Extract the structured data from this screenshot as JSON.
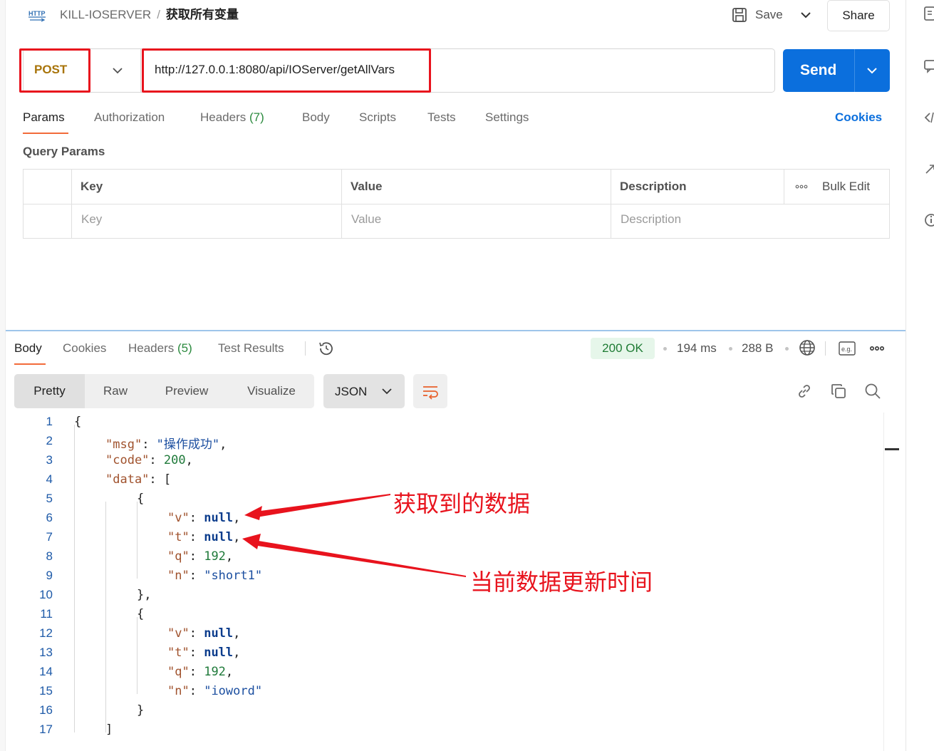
{
  "header": {
    "http_badge": "HTTP",
    "collection": "KILL-IOSERVER",
    "separator": "/",
    "request_name": "获取所有变量",
    "save_label": "Save",
    "share_label": "Share"
  },
  "request": {
    "method": "POST",
    "url": "http://127.0.0.1:8080/api/IOServer/getAllVars",
    "send_label": "Send"
  },
  "request_tabs": {
    "params": "Params",
    "authorization": "Authorization",
    "headers": "Headers",
    "headers_count": "(7)",
    "body": "Body",
    "scripts": "Scripts",
    "tests": "Tests",
    "settings": "Settings",
    "cookies": "Cookies"
  },
  "query_params": {
    "title": "Query Params",
    "columns": [
      "Key",
      "Value",
      "Description"
    ],
    "bulk_edit": "Bulk Edit",
    "placeholders": [
      "Key",
      "Value",
      "Description"
    ]
  },
  "response_tabs": {
    "body": "Body",
    "cookies": "Cookies",
    "headers": "Headers",
    "headers_count": "(5)",
    "test_results": "Test Results"
  },
  "response_meta": {
    "status": "200 OK",
    "time": "194 ms",
    "size": "288 B",
    "status_color": "#1e7b34"
  },
  "format_toolbar": {
    "modes": [
      "Pretty",
      "Raw",
      "Preview",
      "Visualize"
    ],
    "selected_mode": "Pretty",
    "language": "JSON"
  },
  "code": {
    "line_numbers": [
      "1",
      "2",
      "3",
      "4",
      "5",
      "6",
      "7",
      "8",
      "9",
      "10",
      "11",
      "12",
      "13",
      "14",
      "15",
      "16",
      "17"
    ],
    "lines": [
      {
        "parts": [
          {
            "c": "p",
            "t": "{"
          }
        ]
      },
      {
        "parts": [
          {
            "c": "k",
            "t": "\"msg\""
          },
          {
            "c": "p",
            "t": ": "
          },
          {
            "c": "s",
            "t": "\"操作成功\""
          },
          {
            "c": "p",
            "t": ","
          }
        ]
      },
      {
        "parts": [
          {
            "c": "k",
            "t": "\"code\""
          },
          {
            "c": "p",
            "t": ": "
          },
          {
            "c": "n",
            "t": "200"
          },
          {
            "c": "p",
            "t": ","
          }
        ]
      },
      {
        "parts": [
          {
            "c": "k",
            "t": "\"data\""
          },
          {
            "c": "p",
            "t": ": ["
          }
        ]
      },
      {
        "parts": [
          {
            "c": "p",
            "t": "{"
          }
        ]
      },
      {
        "parts": [
          {
            "c": "k",
            "t": "\"v\""
          },
          {
            "c": "p",
            "t": ": "
          },
          {
            "c": "nl",
            "t": "null"
          },
          {
            "c": "p",
            "t": ","
          }
        ]
      },
      {
        "parts": [
          {
            "c": "k",
            "t": "\"t\""
          },
          {
            "c": "p",
            "t": ": "
          },
          {
            "c": "nl",
            "t": "null"
          },
          {
            "c": "p",
            "t": ","
          }
        ]
      },
      {
        "parts": [
          {
            "c": "k",
            "t": "\"q\""
          },
          {
            "c": "p",
            "t": ": "
          },
          {
            "c": "n",
            "t": "192"
          },
          {
            "c": "p",
            "t": ","
          }
        ]
      },
      {
        "parts": [
          {
            "c": "k",
            "t": "\"n\""
          },
          {
            "c": "p",
            "t": ": "
          },
          {
            "c": "s",
            "t": "\"short1\""
          }
        ]
      },
      {
        "parts": [
          {
            "c": "p",
            "t": "},"
          }
        ]
      },
      {
        "parts": [
          {
            "c": "p",
            "t": "{"
          }
        ]
      },
      {
        "parts": [
          {
            "c": "k",
            "t": "\"v\""
          },
          {
            "c": "p",
            "t": ": "
          },
          {
            "c": "nl",
            "t": "null"
          },
          {
            "c": "p",
            "t": ","
          }
        ]
      },
      {
        "parts": [
          {
            "c": "k",
            "t": "\"t\""
          },
          {
            "c": "p",
            "t": ": "
          },
          {
            "c": "nl",
            "t": "null"
          },
          {
            "c": "p",
            "t": ","
          }
        ]
      },
      {
        "parts": [
          {
            "c": "k",
            "t": "\"q\""
          },
          {
            "c": "p",
            "t": ": "
          },
          {
            "c": "n",
            "t": "192"
          },
          {
            "c": "p",
            "t": ","
          }
        ]
      },
      {
        "parts": [
          {
            "c": "k",
            "t": "\"n\""
          },
          {
            "c": "p",
            "t": ": "
          },
          {
            "c": "s",
            "t": "\"ioword\""
          }
        ]
      },
      {
        "parts": [
          {
            "c": "p",
            "t": "}"
          }
        ]
      },
      {
        "parts": [
          {
            "c": "p",
            "t": "]"
          }
        ]
      }
    ]
  },
  "annotations": {
    "data_label": "获取到的数据",
    "time_label": "当前数据更新时间",
    "color": "#e8131d"
  },
  "icons": {
    "http": "http-request-icon",
    "save": "save-icon",
    "history": "history-icon",
    "globe": "globe-icon",
    "example": "example-icon",
    "more": "more-options-icon",
    "wrap": "wrap-lines-icon",
    "link": "link-icon",
    "copy": "copy-icon",
    "search": "search-icon"
  }
}
